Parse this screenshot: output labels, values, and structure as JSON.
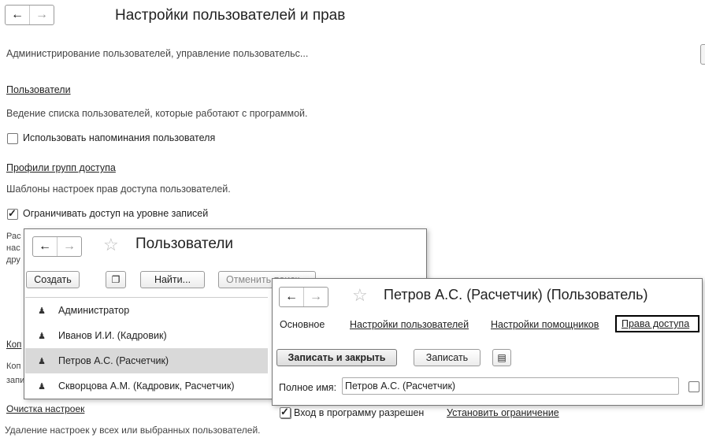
{
  "main": {
    "title": "Настройки пользователей и прав",
    "admin_desc": "Администрирование пользователей, управление пользовательс...",
    "users_link": "Пользователи",
    "users_desc": "Ведение списка пользователей, которые работают с программой.",
    "reminders_checkbox": "Использовать напоминания пользователя",
    "profiles_link": "Профили групп доступа",
    "profiles_desc": "Шаблоны настроек прав доступа пользователей.",
    "restrict_checkbox": "Ограничивать доступ на уровне записей",
    "partial_ras": "Рас",
    "partial_nas": "нас",
    "partial_dru": "дру",
    "partial_kop_link": "Коп",
    "partial_kop": "Коп",
    "partial_zap": "запи",
    "clear_link": "Очистка настроек",
    "clear_desc": "Удаление настроек у всех или выбранных пользователей."
  },
  "users_window": {
    "title": "Пользователи",
    "create_button": "Создать",
    "find_button": "Найти...",
    "cancel_search_button": "Отменить поиск",
    "users": [
      {
        "name": "Администратор",
        "selected": false
      },
      {
        "name": "Иванов И.И. (Кадровик)",
        "selected": false
      },
      {
        "name": "Петров А.С. (Расчетчик)",
        "selected": true
      },
      {
        "name": "Скворцова А.М. (Кадровик, Расчетчик)",
        "selected": false
      }
    ]
  },
  "user_window": {
    "title": "Петров А.С. (Расчетчик) (Пользователь)",
    "tabs": [
      "Основное",
      "Настройки пользователей",
      "Настройки помощников",
      "Права доступа"
    ],
    "active_tab_highlight": "Права доступа",
    "save_close_button": "Записать и закрыть",
    "save_button": "Записать",
    "fullname_label": "Полное имя:",
    "fullname_value": "Петров А.С. (Расчетчик)",
    "login_allowed_checkbox": "Вход в программу разрешен",
    "set_restriction_link": "Установить ограничение"
  },
  "colors": {
    "selected_row": "#d9d9d9",
    "border": "#777777",
    "highlight_box": "#000000"
  }
}
